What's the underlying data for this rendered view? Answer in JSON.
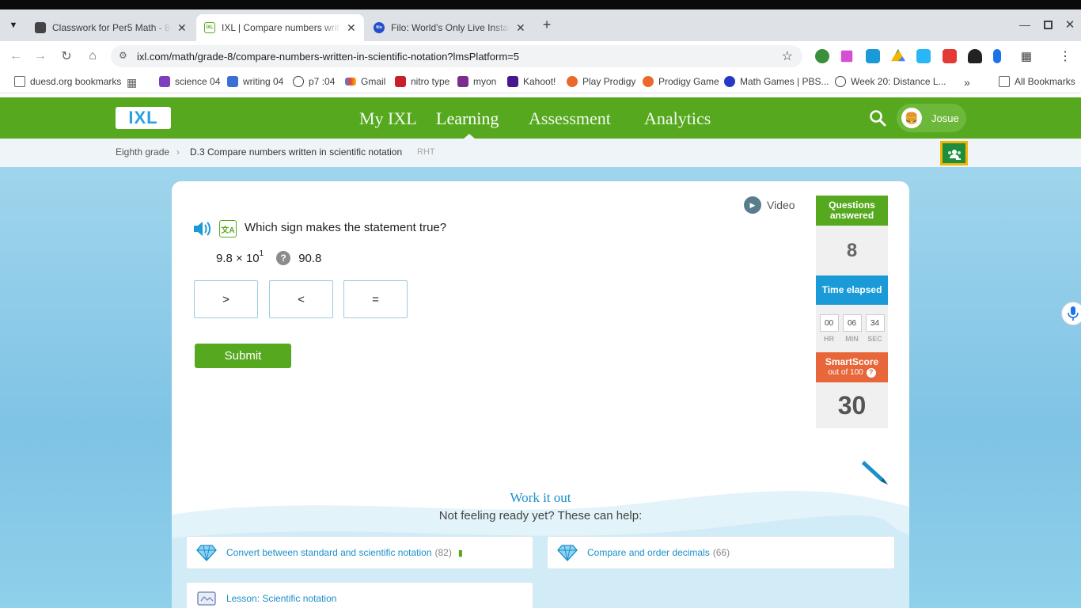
{
  "browser": {
    "tabs": [
      {
        "title": "Classwork for Per5 Math - 8th G",
        "active": false
      },
      {
        "title": "IXL | Compare numbers written in scientific notation",
        "active": true
      },
      {
        "title": "Filo: World's Only Live Instant Tutoring",
        "active": false
      }
    ],
    "url": "ixl.com/math/grade-8/compare-numbers-written-in-scientific-notation?lmsPlatform=5",
    "bookmarks": [
      {
        "label": "duesd.org bookmarks",
        "icon": "folder-icon"
      },
      {
        "label": "science 04",
        "icon": "classroom-icon",
        "color": "#7b3fbf"
      },
      {
        "label": "writing 04",
        "icon": "classroom-icon",
        "color": "#3b6fd6"
      },
      {
        "label": "p7 :04",
        "icon": "globe-icon"
      },
      {
        "label": "Gmail",
        "icon": "gmail-icon"
      },
      {
        "label": "nitro type",
        "icon": "nitro-icon",
        "color": "#c6202d"
      },
      {
        "label": "myon",
        "icon": "myon-icon",
        "color": "#7b2c8c"
      },
      {
        "label": "Kahoot!",
        "icon": "kahoot-icon",
        "color": "#46178f"
      },
      {
        "label": "Play Prodigy",
        "icon": "prodigy-icon",
        "color": "#e96a2c"
      },
      {
        "label": "Prodigy Game",
        "icon": "prodigy-icon",
        "color": "#e96a2c"
      },
      {
        "label": "Math Games | PBS...",
        "icon": "pbs-icon",
        "color": "#2638c4"
      },
      {
        "label": "Week 20: Distance L...",
        "icon": "globe-icon"
      }
    ],
    "all_bookmarks": "All Bookmarks"
  },
  "ixl": {
    "logo": "IXL",
    "nav": [
      "My IXL",
      "Learning",
      "Assessment",
      "Analytics"
    ],
    "active_nav": "Learning",
    "user": "Josue",
    "breadcrumb": {
      "grade": "Eighth grade",
      "skill": "D.3 Compare numbers written in scientific notation",
      "code": "RHT"
    }
  },
  "question": {
    "video_label": "Video",
    "prompt": "Which sign makes the statement true?",
    "left_base": "9.8 × 10",
    "left_exponent": "1",
    "unknown": "?",
    "right": "90.8",
    "choices": [
      ">",
      "<",
      "="
    ],
    "submit": "Submit"
  },
  "stats": {
    "questions_answered_label": "Questions answered",
    "questions_answered": "8",
    "time_elapsed_label": "Time elapsed",
    "time": {
      "hr": "00",
      "min": "06",
      "sec": "34"
    },
    "time_units": {
      "hr": "HR",
      "min": "MIN",
      "sec": "SEC"
    },
    "smartscore_label": "SmartScore",
    "smartscore_sub": "out of 100",
    "smartscore": "30",
    "colors": {
      "questions": "#56a91f",
      "time": "#1a9ad6",
      "smartscore": "#e8673a"
    }
  },
  "help": {
    "title": "Work it out",
    "subtitle": "Not feeling ready yet? These can help:",
    "items": [
      {
        "label": "Convert between standard and scientific notation",
        "count": "(82)",
        "icon": "diamond-icon"
      },
      {
        "label": "Compare and order decimals",
        "count": "(66)",
        "icon": "diamond-icon"
      },
      {
        "label": "Lesson: Scientific notation",
        "count": "",
        "icon": "lesson-icon"
      }
    ]
  }
}
